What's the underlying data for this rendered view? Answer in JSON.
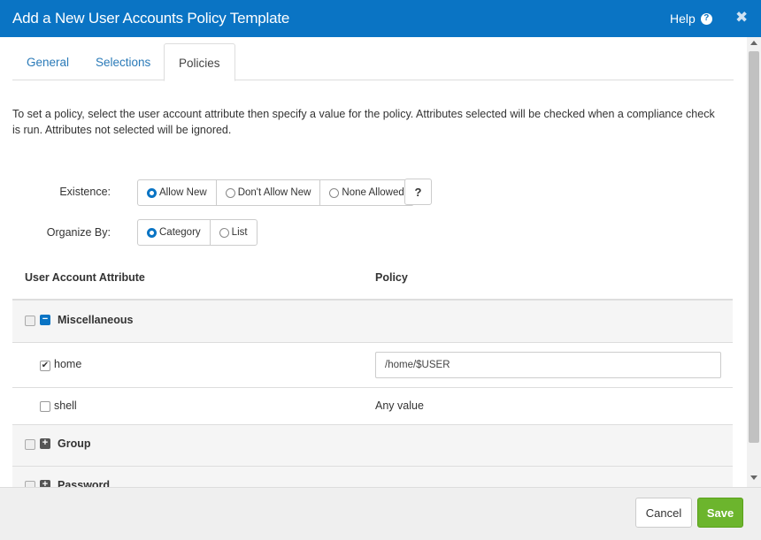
{
  "dialog": {
    "title": "Add a New User Accounts Policy Template",
    "help_label": "Help",
    "help_icon": "question-circle-icon",
    "close_glyph": "✖"
  },
  "tabs": [
    {
      "label": "General",
      "active": false
    },
    {
      "label": "Selections",
      "active": false
    },
    {
      "label": "Policies",
      "active": true
    }
  ],
  "description": "To set a policy, select the user account attribute then specify a value for the policy. Attributes selected will be checked when a compliance check is run. Attributes not selected will be ignored.",
  "existence": {
    "label": "Existence:",
    "options": [
      {
        "label": "Allow New",
        "selected": true
      },
      {
        "label": "Don't Allow New",
        "selected": false
      },
      {
        "label": "None Allowed",
        "selected": false
      }
    ],
    "help_button": "?"
  },
  "organize_by": {
    "label": "Organize By:",
    "options": [
      {
        "label": "Category",
        "selected": true
      },
      {
        "label": "List",
        "selected": false
      }
    ]
  },
  "grid": {
    "headers": [
      "User Account Attribute",
      "Policy"
    ],
    "rows": [
      {
        "type": "category",
        "label": "Miscellaneous",
        "expanded": true,
        "checked": false
      },
      {
        "type": "attribute",
        "label": "home",
        "checked": true,
        "policy_value": "/home/$USER"
      },
      {
        "type": "attribute",
        "label": "shell",
        "checked": false,
        "policy_text": "Any value"
      },
      {
        "type": "category",
        "label": "Group",
        "expanded": false,
        "checked": false
      },
      {
        "type": "category",
        "label": "Password",
        "expanded": false,
        "checked": false
      }
    ]
  },
  "footer": {
    "cancel_label": "Cancel",
    "save_label": "Save"
  },
  "colors": {
    "titlebar": "#0a74c4",
    "tab_link": "#2a7ab8",
    "save_button": "#6cb52d"
  }
}
